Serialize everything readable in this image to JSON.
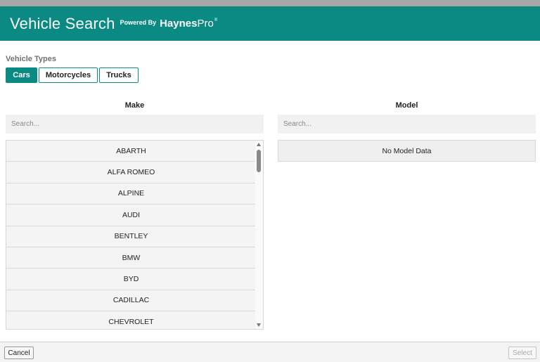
{
  "header": {
    "title": "Vehicle Search",
    "powered_by": "Powered By",
    "brand_main": "Haynes",
    "brand_pro": "Pro",
    "brand_mark": "®",
    "accent_color": "#0b8a83"
  },
  "vehicle_types": {
    "label": "Vehicle Types",
    "tabs": [
      {
        "label": "Cars",
        "active": true
      },
      {
        "label": "Motorcycles",
        "active": false
      },
      {
        "label": "Trucks",
        "active": false
      }
    ]
  },
  "make": {
    "heading": "Make",
    "search_placeholder": "Search...",
    "items": [
      "ABARTH",
      "ALFA ROMEO",
      "ALPINE",
      "AUDI",
      "BENTLEY",
      "BMW",
      "BYD",
      "CADILLAC",
      "CHEVROLET"
    ]
  },
  "model": {
    "heading": "Model",
    "search_placeholder": "Search...",
    "empty_text": "No Model Data"
  },
  "footer": {
    "cancel_label": "Cancel",
    "select_label": "Select"
  }
}
